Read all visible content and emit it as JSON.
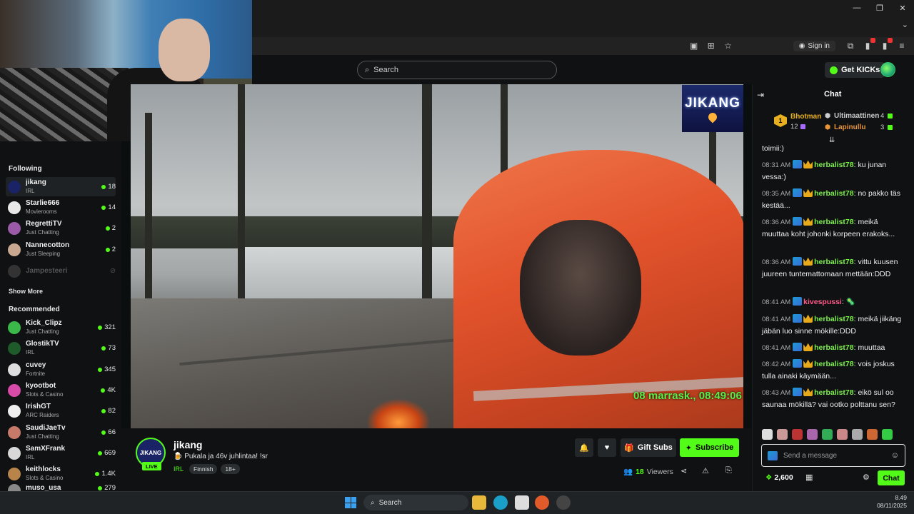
{
  "browser": {
    "signin_label": "Sign in"
  },
  "header": {
    "search_placeholder": "Search",
    "get_kicks_label": "Get KICKs"
  },
  "sidebar": {
    "following_title": "Following",
    "following": [
      {
        "name": "jikang",
        "category": "IRL",
        "viewers": "18",
        "live": true,
        "color": "#1a2366"
      },
      {
        "name": "Starlie666",
        "category": "Movierooms",
        "viewers": "14",
        "live": true,
        "color": "#e8e8e8"
      },
      {
        "name": "RegrettiTV",
        "category": "Just Chatting",
        "viewers": "2",
        "live": true,
        "color": "#9a5aa8"
      },
      {
        "name": "Nannecotton",
        "category": "Just Sleeping",
        "viewers": "2",
        "live": true,
        "color": "#c8a890"
      },
      {
        "name": "Jampesteeri",
        "category": "",
        "viewers": "",
        "live": false,
        "color": "#333"
      }
    ],
    "show_more": "Show More",
    "recommended_title": "Recommended",
    "recommended": [
      {
        "name": "Kick_Clipz",
        "category": "Just Chatting",
        "viewers": "321",
        "color": "#3ab84a"
      },
      {
        "name": "GlostikTV",
        "category": "IRL",
        "viewers": "73",
        "color": "#1e5a2a"
      },
      {
        "name": "cuvey",
        "category": "Fortnite",
        "viewers": "345",
        "color": "#ddd"
      },
      {
        "name": "kyootbot",
        "category": "Slots & Casino",
        "viewers": "4K",
        "color": "#d84aa8"
      },
      {
        "name": "IrishGT",
        "category": "ARC Raiders",
        "viewers": "82",
        "color": "#eee"
      },
      {
        "name": "SaudiJaeTv",
        "category": "Just Chatting",
        "viewers": "66",
        "color": "#c87a6a"
      },
      {
        "name": "SamXFrank",
        "category": "IRL",
        "viewers": "669",
        "color": "#d8d8d8"
      },
      {
        "name": "keithlocks",
        "category": "Slots & Casino",
        "viewers": "1.4K",
        "color": "#b8844a"
      },
      {
        "name": "muso_usa",
        "category": "",
        "viewers": "279",
        "color": "#888"
      }
    ]
  },
  "video": {
    "timestamp": "08 marrask., 08:49:06",
    "logo_text": "JIKANG"
  },
  "channel": {
    "avatar_text": "JIKANG",
    "live_label": "LIVE",
    "name": "jikang",
    "title": "🍺 Pukala ja 46v juhlintaa! !sr",
    "category": "IRL",
    "tags": [
      "Finnish",
      "18+"
    ],
    "gift_subs_label": "Gift Subs",
    "subscribe_label": "Subscribe",
    "viewers_count": "18",
    "viewers_label": "Viewers"
  },
  "chat": {
    "title": "Chat",
    "leaderboard": {
      "first": {
        "rank": "1",
        "name": "Bhotman",
        "count": "12"
      },
      "second": {
        "name": "Ultimaattinen",
        "count": "4"
      },
      "third": {
        "name": "Lapinullu",
        "count": "3"
      }
    },
    "partial_top": "toimii:)",
    "messages": [
      {
        "time": "08:31 AM",
        "user": "herbalist78",
        "text": "ku junan vessa:)",
        "badges": [
          "kick",
          "crown"
        ],
        "pink": false
      },
      {
        "time": "08:35 AM",
        "user": "herbalist78",
        "text": "no pakko täs kestää...",
        "badges": [
          "kick",
          "crown"
        ],
        "pink": false
      },
      {
        "time": "08:36 AM",
        "user": "herbalist78",
        "text": "meikä muuttaa koht johonki korpeen erakoks...",
        "badges": [
          "kick",
          "crown"
        ],
        "pink": false
      },
      {
        "time": "08:36 AM",
        "user": "herbalist78",
        "text": "vittu kuusen juureen tuntemattomaan mettään:DDD",
        "badges": [
          "kick",
          "crown"
        ],
        "pink": false
      },
      {
        "time": "08:41 AM",
        "user": "kivespussi",
        "text": "🦠",
        "badges": [
          "kick"
        ],
        "pink": true
      },
      {
        "time": "08:41 AM",
        "user": "herbalist78",
        "text": "meikä jiikäng jäbän luo sinne mökille:DDD",
        "badges": [
          "kick",
          "crown"
        ],
        "pink": false
      },
      {
        "time": "08:41 AM",
        "user": "herbalist78",
        "text": "muuttaa",
        "badges": [
          "kick",
          "crown"
        ],
        "pink": false
      },
      {
        "time": "08:42 AM",
        "user": "herbalist78",
        "text": "vois joskus tulla ainaki käymään...",
        "badges": [
          "kick",
          "crown"
        ],
        "pink": false
      },
      {
        "time": "08:43 AM",
        "user": "herbalist78",
        "text": "eikö sul oo saunaa mökillä? vai ootko polttanu sen?",
        "badges": [
          "kick",
          "crown"
        ],
        "pink": false
      }
    ],
    "input_placeholder": "Send a message",
    "points": "2,600",
    "send_label": "Chat"
  },
  "taskbar": {
    "search_label": "Search",
    "time": "8.49",
    "date": "08/11/2025"
  }
}
